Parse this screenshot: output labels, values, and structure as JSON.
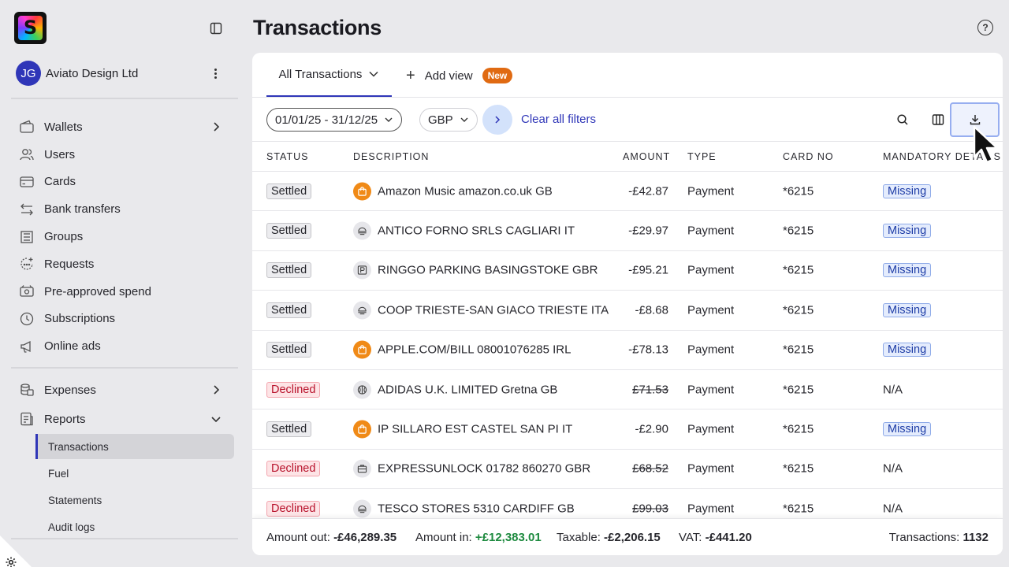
{
  "app": {
    "logo_letter": "S"
  },
  "account": {
    "initials": "JG",
    "name": "Aviato Design Ltd"
  },
  "sidebar": {
    "items": [
      {
        "label": "Wallets",
        "icon": "wallet-icon",
        "chevron": "right"
      },
      {
        "label": "Users",
        "icon": "users-icon"
      },
      {
        "label": "Cards",
        "icon": "card-icon"
      },
      {
        "label": "Bank transfers",
        "icon": "transfer-icon"
      },
      {
        "label": "Groups",
        "icon": "groups-icon"
      },
      {
        "label": "Requests",
        "icon": "request-icon"
      },
      {
        "label": "Pre-approved spend",
        "icon": "pre-approved-icon"
      },
      {
        "label": "Subscriptions",
        "icon": "clock-icon"
      },
      {
        "label": "Online ads",
        "icon": "megaphone-icon"
      }
    ],
    "items2": [
      {
        "label": "Expenses",
        "icon": "expenses-icon",
        "chevron": "right"
      },
      {
        "label": "Reports",
        "icon": "reports-icon",
        "chevron": "down"
      }
    ],
    "report_items": [
      {
        "label": "Transactions",
        "active": true
      },
      {
        "label": "Fuel"
      },
      {
        "label": "Statements"
      },
      {
        "label": "Audit logs"
      }
    ]
  },
  "page": {
    "title": "Transactions",
    "help": "?"
  },
  "tabs": {
    "active": "All Transactions",
    "add_view": "Add view",
    "new_badge": "New"
  },
  "filters": {
    "date_range": "01/01/25 - 31/12/25",
    "currency": "GBP",
    "clear": "Clear all filters"
  },
  "table": {
    "headers": [
      "STATUS",
      "DESCRIPTION",
      "AMOUNT",
      "TYPE",
      "CARD NO",
      "MANDATORY DETAILS"
    ],
    "rows": [
      {
        "status": "Settled",
        "icon": "shopping-bag-icon",
        "icon_style": "orange",
        "description": "Amazon Music amazon.co.uk GB",
        "amount": "-£42.87",
        "struck": false,
        "type": "Payment",
        "card": "*6215",
        "mandatory": "Missing"
      },
      {
        "status": "Settled",
        "icon": "food-icon",
        "icon_style": "grey",
        "description": "ANTICO FORNO SRLS CAGLIARI IT",
        "amount": "-£29.97",
        "struck": false,
        "type": "Payment",
        "card": "*6215",
        "mandatory": "Missing"
      },
      {
        "status": "Settled",
        "icon": "parking-icon",
        "icon_style": "grey",
        "description": "RINGGO PARKING BASINGSTOKE GBR",
        "amount": "-£95.21",
        "struck": false,
        "type": "Payment",
        "card": "*6215",
        "mandatory": "Missing"
      },
      {
        "status": "Settled",
        "icon": "food-icon",
        "icon_style": "grey",
        "description": "COOP TRIESTE-SAN GIACO TRIESTE ITA",
        "amount": "-£8.68",
        "struck": false,
        "type": "Payment",
        "card": "*6215",
        "mandatory": "Missing"
      },
      {
        "status": "Settled",
        "icon": "shopping-bag-icon",
        "icon_style": "orange",
        "description": "APPLE.COM/BILL 08001076285 IRL",
        "amount": "-£78.13",
        "struck": false,
        "type": "Payment",
        "card": "*6215",
        "mandatory": "Missing"
      },
      {
        "status": "Declined",
        "icon": "sports-ball-icon",
        "icon_style": "grey",
        "description": "ADIDAS U.K. LIMITED Gretna GB",
        "amount": "£71.53",
        "struck": true,
        "type": "Payment",
        "card": "*6215",
        "mandatory": "N/A"
      },
      {
        "status": "Settled",
        "icon": "shopping-bag-icon",
        "icon_style": "orange",
        "description": "IP SILLARO EST CASTEL SAN PI IT",
        "amount": "-£2.90",
        "struck": false,
        "type": "Payment",
        "card": "*6215",
        "mandatory": "Missing"
      },
      {
        "status": "Declined",
        "icon": "briefcase-icon",
        "icon_style": "grey",
        "description": "EXPRESSUNLOCK 01782 860270 GBR",
        "amount": "£68.52",
        "struck": true,
        "type": "Payment",
        "card": "*6215",
        "mandatory": "N/A"
      },
      {
        "status": "Declined",
        "icon": "food-icon",
        "icon_style": "grey",
        "description": "TESCO STORES 5310 CARDIFF GB",
        "amount": "£99.03",
        "struck": true,
        "type": "Payment",
        "card": "*6215",
        "mandatory": "N/A"
      }
    ]
  },
  "footer": {
    "out_label": "Amount out:",
    "out_value": "-£46,289.35",
    "in_label": "Amount in:",
    "in_value": "+£12,383.01",
    "tax_label": "Taxable:",
    "tax_value": "-£2,206.15",
    "vat_label": "VAT:",
    "vat_value": "-£441.20",
    "count_label": "Transactions:",
    "count_value": "1132"
  },
  "colors": {
    "accent": "#2f36b8",
    "new_badge": "#e06a12",
    "declined": "#b8122b",
    "positive": "#1d8a3f",
    "merchant_orange": "#f08a17"
  }
}
